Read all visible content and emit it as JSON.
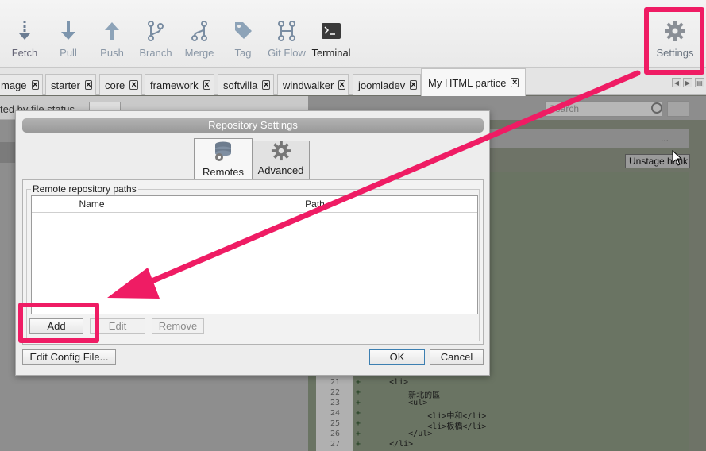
{
  "toolbar": {
    "items": [
      {
        "label": "Fetch",
        "icon": "fetch-icon"
      },
      {
        "label": "Pull",
        "icon": "pull-icon"
      },
      {
        "label": "Push",
        "icon": "push-icon"
      },
      {
        "label": "Branch",
        "icon": "branch-icon"
      },
      {
        "label": "Merge",
        "icon": "merge-icon"
      },
      {
        "label": "Tag",
        "icon": "tag-icon"
      },
      {
        "label": "Git Flow",
        "icon": "git-flow-icon"
      },
      {
        "label": "Terminal",
        "icon": "terminal-icon"
      }
    ],
    "settings_label": "Settings"
  },
  "tabs": [
    {
      "label": "mage"
    },
    {
      "label": "starter"
    },
    {
      "label": "core"
    },
    {
      "label": "framework"
    },
    {
      "label": "softvilla"
    },
    {
      "label": "windwalker"
    },
    {
      "label": "joomladev"
    },
    {
      "label": "My HTML partice"
    }
  ],
  "background": {
    "left_header_text": "ted by file status",
    "search_placeholder": "Search",
    "hunk_menu": "...",
    "unstage_label": "Unstage hunk",
    "code_lines": [
      {
        "ln": "21",
        "mark": "+",
        "src": "    <li>"
      },
      {
        "ln": "22",
        "mark": "+",
        "src": "        新北的區"
      },
      {
        "ln": "23",
        "mark": "+",
        "src": "        <ul>"
      },
      {
        "ln": "24",
        "mark": "+",
        "src": "            <li>中和</li>"
      },
      {
        "ln": "25",
        "mark": "+",
        "src": "            <li>板橋</li>"
      },
      {
        "ln": "26",
        "mark": "+",
        "src": "        </ul>"
      },
      {
        "ln": "27",
        "mark": "+",
        "src": "    </li>"
      }
    ]
  },
  "dialog": {
    "title": "Repository Settings",
    "tabs": [
      {
        "label": "Remotes",
        "icon": "database-gear-icon"
      },
      {
        "label": "Advanced",
        "icon": "gear-icon"
      }
    ],
    "group_label": "Remote repository paths",
    "columns": [
      "Name",
      "Path"
    ],
    "buttons": {
      "add": "Add",
      "edit": "Edit",
      "remove": "Remove",
      "edit_config": "Edit Config File...",
      "ok": "OK",
      "cancel": "Cancel"
    }
  },
  "annotation": {
    "color": "#ef1c64"
  }
}
